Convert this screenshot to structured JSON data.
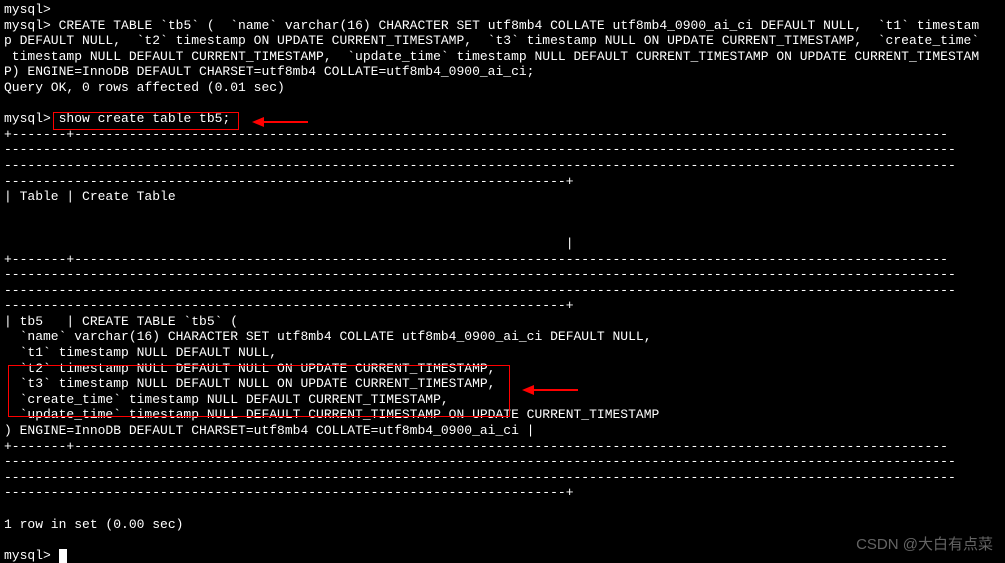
{
  "prompt": "mysql>",
  "create_stmt_line1": "CREATE TABLE `tb5` (  `name` varchar(16) CHARACTER SET utf8mb4 COLLATE utf8mb4_0900_ai_ci DEFAULT NULL,  `t1` timestam",
  "create_stmt_line2": "p DEFAULT NULL,  `t2` timestamp ON UPDATE CURRENT_TIMESTAMP,  `t3` timestamp NULL ON UPDATE CURRENT_TIMESTAMP,  `create_time`",
  "create_stmt_line3": " timestamp NULL DEFAULT CURRENT_TIMESTAMP,  `update_time` timestamp NULL DEFAULT CURRENT_TIMESTAMP ON UPDATE CURRENT_TIMESTAM",
  "create_stmt_line4": "P) ENGINE=InnoDB DEFAULT CHARSET=utf8mb4 COLLATE=utf8mb4_0900_ai_ci;",
  "query_ok": "Query OK, 0 rows affected (0.01 sec)",
  "show_cmd": "show create table tb5;",
  "dash_full": "+-------+----------------------------------------------------------------------------------------------------------------",
  "dash_cont": "--------------------------------------------------------------------------------------------------------------------------",
  "dash_end": "------------------------------------------------------------------------+",
  "header_row": "| Table | Create Table",
  "header_end": "                                                                        |",
  "result_l1": "| tb5   | CREATE TABLE `tb5` (",
  "result_l2": "  `name` varchar(16) CHARACTER SET utf8mb4 COLLATE utf8mb4_0900_ai_ci DEFAULT NULL,",
  "result_l3": "  `t1` timestamp NULL DEFAULT NULL,",
  "result_l4": "  `t2` timestamp NULL DEFAULT NULL ON UPDATE CURRENT_TIMESTAMP,",
  "result_l5": "  `t3` timestamp NULL DEFAULT NULL ON UPDATE CURRENT_TIMESTAMP,",
  "result_l6": "  `create_time` timestamp NULL DEFAULT CURRENT_TIMESTAMP,",
  "result_l7": "  `update_time` timestamp NULL DEFAULT CURRENT_TIMESTAMP ON UPDATE CURRENT_TIMESTAMP",
  "result_l8": ") ENGINE=InnoDB DEFAULT CHARSET=utf8mb4 COLLATE=utf8mb4_0900_ai_ci |",
  "rows_set": "1 row in set (0.00 sec)",
  "watermark": "CSDN @大白有点菜"
}
